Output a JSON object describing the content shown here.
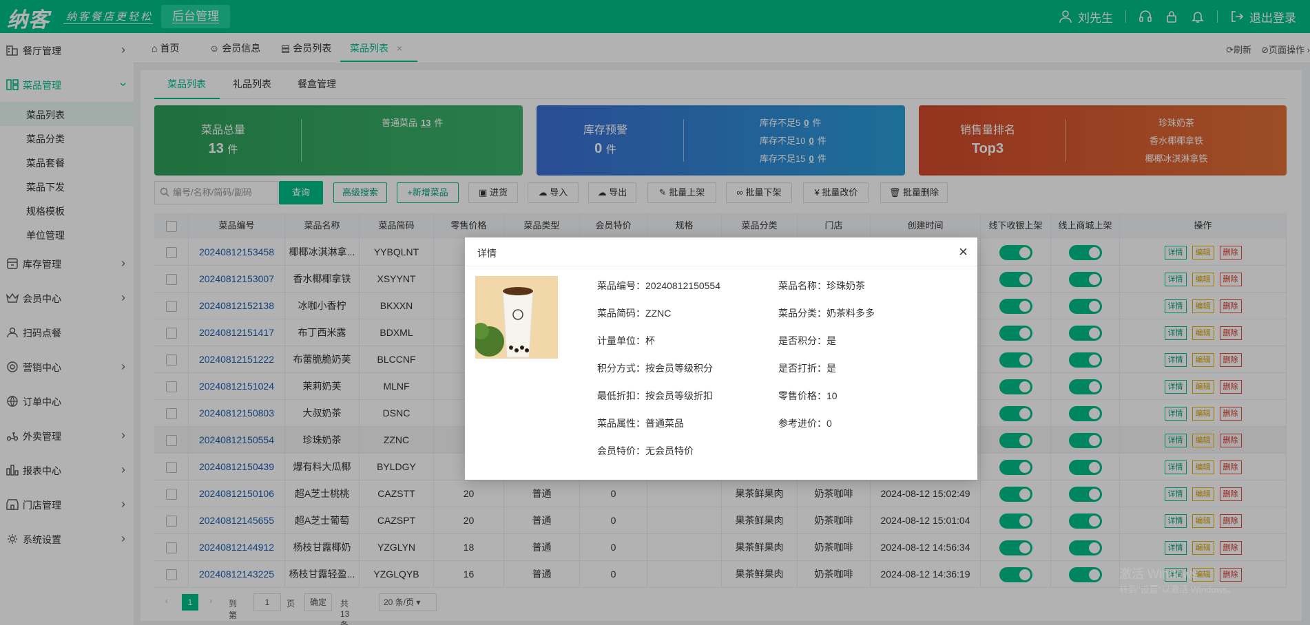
{
  "header": {
    "logo": "纳客",
    "slogan": "纳客餐店更轻松",
    "admin_tab": "后台管理",
    "user": "刘先生",
    "logout": "退出登录"
  },
  "sidebar": {
    "items": [
      {
        "label": "餐厅管理",
        "icon": "restaurant-icon"
      },
      {
        "label": "菜品管理",
        "icon": "dish-icon"
      },
      {
        "label": "库存管理",
        "icon": "inventory-icon"
      },
      {
        "label": "会员中心",
        "icon": "crown-icon"
      },
      {
        "label": "扫码点餐",
        "icon": "user-icon"
      },
      {
        "label": "营销中心",
        "icon": "target-icon"
      },
      {
        "label": "订单中心",
        "icon": "globe-icon"
      },
      {
        "label": "外卖管理",
        "icon": "scooter-icon"
      },
      {
        "label": "报表中心",
        "icon": "bar-chart-icon"
      },
      {
        "label": "门店管理",
        "icon": "store-icon"
      },
      {
        "label": "系统设置",
        "icon": "gear-icon"
      }
    ],
    "sub_items": [
      "菜品列表",
      "菜品分类",
      "菜品套餐",
      "菜品下发",
      "规格模板",
      "单位管理"
    ]
  },
  "tabs": {
    "home": "首页",
    "member_info": "会员信息",
    "member_list": "会员列表",
    "dish_list": "菜品列表",
    "refresh": "刷新",
    "page_ops": "页面操作"
  },
  "subtabs": [
    "菜品列表",
    "礼品列表",
    "餐盒管理"
  ],
  "cards": {
    "total": {
      "title": "菜品总量",
      "value": "13",
      "unit": "件",
      "right_label": "普通菜品",
      "right_value": "13",
      "right_unit": "件"
    },
    "stock": {
      "title": "库存预警",
      "value": "0",
      "unit": "件",
      "lines": [
        {
          "label": "库存不足5",
          "value": "0",
          "unit": "件"
        },
        {
          "label": "库存不足10",
          "value": "0",
          "unit": "件"
        },
        {
          "label": "库存不足15",
          "value": "0",
          "unit": "件"
        }
      ]
    },
    "sales": {
      "title": "销售量排名",
      "value": "Top3",
      "lines": [
        "珍珠奶茶",
        "香水椰椰拿铁",
        "椰椰冰淇淋拿铁"
      ]
    }
  },
  "toolbar": {
    "search_placeholder": "编号/名称/简码/副码",
    "query": "查询",
    "advanced": "高级搜索",
    "add": "+新增菜品",
    "stock_in": "进货",
    "import": "导入",
    "export": "导出",
    "batch_on": "批量上架",
    "batch_off": "批量下架",
    "batch_price": "批量改价",
    "batch_delete": "批量删除"
  },
  "table": {
    "headers": [
      "菜品编号",
      "菜品名称",
      "菜品简码",
      "零售价格",
      "菜品类型",
      "会员特价",
      "规格",
      "菜品分类",
      "门店",
      "创建时间",
      "线下收银上架",
      "线上商城上架",
      "操作"
    ],
    "op_labels": {
      "detail": "详情",
      "edit": "编辑",
      "delete": "删除"
    },
    "rows": [
      {
        "code": "20240812153458",
        "name": "椰椰冰淇淋拿...",
        "short": "YYBQLNT",
        "price": "",
        "type": "",
        "vip": "",
        "spec": "",
        "cat": "",
        "store": "",
        "time": ""
      },
      {
        "code": "20240812153007",
        "name": "香水椰椰拿铁",
        "short": "XSYYNT",
        "price": "",
        "type": "",
        "vip": "",
        "spec": "",
        "cat": "",
        "store": "",
        "time": ""
      },
      {
        "code": "20240812152138",
        "name": "冰咖小香柠",
        "short": "BKXXN",
        "price": "",
        "type": "",
        "vip": "",
        "spec": "",
        "cat": "",
        "store": "",
        "time": ""
      },
      {
        "code": "20240812151417",
        "name": "布丁西米露",
        "short": "BDXML",
        "price": "",
        "type": "",
        "vip": "",
        "spec": "",
        "cat": "",
        "store": "",
        "time": ""
      },
      {
        "code": "20240812151222",
        "name": "布蕾脆脆奶芙",
        "short": "BLCCNF",
        "price": "",
        "type": "",
        "vip": "",
        "spec": "",
        "cat": "",
        "store": "",
        "time": ""
      },
      {
        "code": "20240812151024",
        "name": "茉莉奶芙",
        "short": "MLNF",
        "price": "",
        "type": "",
        "vip": "",
        "spec": "",
        "cat": "",
        "store": "",
        "time": ""
      },
      {
        "code": "20240812150803",
        "name": "大叔奶茶",
        "short": "DSNC",
        "price": "",
        "type": "",
        "vip": "",
        "spec": "",
        "cat": "",
        "store": "",
        "time": ""
      },
      {
        "code": "20240812150554",
        "name": "珍珠奶茶",
        "short": "ZZNC",
        "price": "",
        "type": "",
        "vip": "",
        "spec": "",
        "cat": "",
        "store": "",
        "time": ""
      },
      {
        "code": "20240812150439",
        "name": "爆有料大瓜椰",
        "short": "BYLDGY",
        "price": "",
        "type": "",
        "vip": "",
        "spec": "",
        "cat": "",
        "store": "",
        "time": ""
      },
      {
        "code": "20240812150106",
        "name": "超A芝士桃桃",
        "short": "CAZSTT",
        "price": "20",
        "type": "普通",
        "vip": "0",
        "spec": "",
        "cat": "果茶鲜果肉",
        "store": "奶茶咖啡",
        "time": "2024-08-12 15:02:49"
      },
      {
        "code": "20240812145655",
        "name": "超A芝士葡萄",
        "short": "CAZSPT",
        "price": "20",
        "type": "普通",
        "vip": "0",
        "spec": "",
        "cat": "果茶鲜果肉",
        "store": "奶茶咖啡",
        "time": "2024-08-12 15:01:04"
      },
      {
        "code": "20240812144912",
        "name": "杨枝甘露椰奶",
        "short": "YZGLYN",
        "price": "18",
        "type": "普通",
        "vip": "0",
        "spec": "",
        "cat": "果茶鲜果肉",
        "store": "奶茶咖啡",
        "time": "2024-08-12 14:56:34"
      },
      {
        "code": "20240812143225",
        "name": "杨枝甘露轻盈...",
        "short": "YZGLQYB",
        "price": "16",
        "type": "普通",
        "vip": "0",
        "spec": "",
        "cat": "果茶鲜果肉",
        "store": "奶茶咖啡",
        "time": "2024-08-12 14:36:19"
      }
    ]
  },
  "pager": {
    "page": "1",
    "goto_label": "到第",
    "goto_value": "1",
    "page_unit": "页",
    "confirm": "确定",
    "total": "共 13 条",
    "page_size": "20 条/页"
  },
  "modal": {
    "title": "详情",
    "fields": [
      {
        "k": "菜品编号：",
        "v": "20240812150554"
      },
      {
        "k": "菜品名称：",
        "v": "珍珠奶茶"
      },
      {
        "k": "菜品简码：",
        "v": "ZZNC"
      },
      {
        "k": "菜品分类：",
        "v": "奶茶料多多"
      },
      {
        "k": "计量单位：",
        "v": "杯"
      },
      {
        "k": "是否积分：",
        "v": "是"
      },
      {
        "k": "积分方式：",
        "v": "按会员等级积分"
      },
      {
        "k": "是否打折：",
        "v": "是"
      },
      {
        "k": "最低折扣：",
        "v": "按会员等级折扣"
      },
      {
        "k": "零售价格：",
        "v": "10"
      },
      {
        "k": "菜品属性：",
        "v": "普通菜品"
      },
      {
        "k": "参考进价：",
        "v": "0"
      },
      {
        "k": "会员特价：",
        "v": "无会员特价"
      }
    ]
  },
  "watermark": {
    "line1": "激活 Windows",
    "line2": "转到\"设置\"以激活 Windows。"
  },
  "colors": {
    "brand": "#00bf8c",
    "card_green": "#2ea55a",
    "card_blue": "#3b74d6",
    "card_red": "#d5502e"
  }
}
